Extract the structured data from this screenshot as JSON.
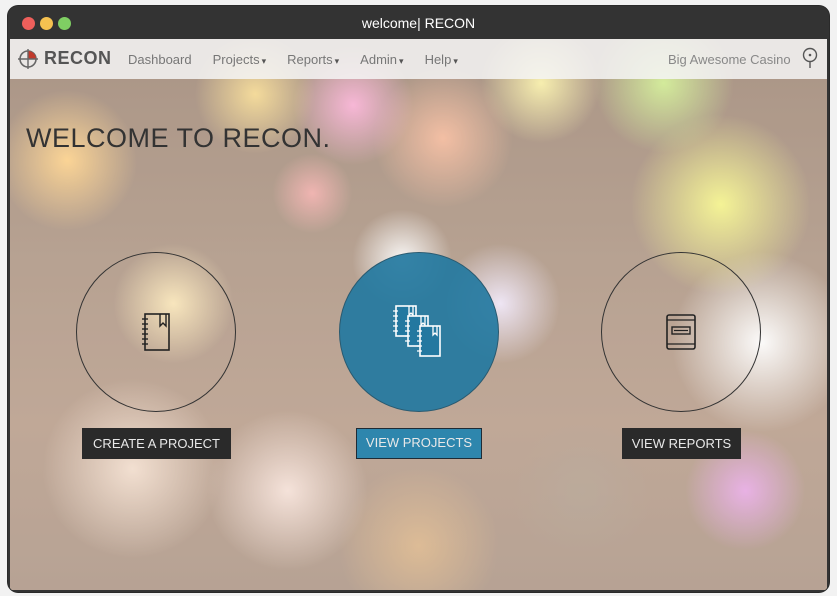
{
  "window": {
    "title": "welcome| RECON"
  },
  "navbar": {
    "brand": "RECON",
    "items": [
      {
        "label": "Dashboard",
        "caret": ""
      },
      {
        "label": "Projects",
        "caret": "▾"
      },
      {
        "label": "Reports",
        "caret": "▾"
      },
      {
        "label": "Admin",
        "caret": "▾"
      },
      {
        "label": "Help",
        "caret": "▾"
      }
    ],
    "property": "Big Awesome Casino"
  },
  "main": {
    "headline": "WELCOME TO RECON.",
    "actions": [
      {
        "label": "CREATE A PROJECT",
        "icon": "notebook-icon"
      },
      {
        "label": "VIEW PROJECTS",
        "icon": "notebooks-stack-icon"
      },
      {
        "label": "VIEW REPORTS",
        "icon": "report-book-icon"
      }
    ]
  },
  "colors": {
    "accent": "#2e86ad",
    "dark": "#2a2a2a"
  }
}
